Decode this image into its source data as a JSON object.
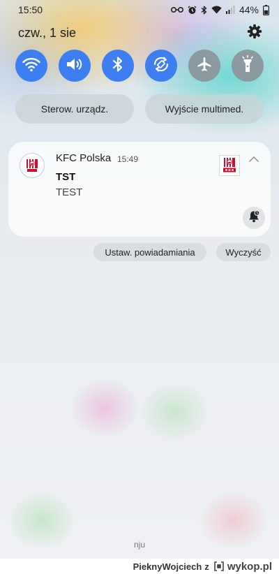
{
  "status_bar": {
    "time": "15:50",
    "battery_percent": "44%",
    "icons": [
      "key-icon",
      "alarm-icon",
      "bluetooth-icon",
      "wifi-icon",
      "signal-icon",
      "battery-icon"
    ]
  },
  "panel": {
    "date": "czw., 1 sie",
    "settings_icon": "gear-icon"
  },
  "quick_settings": [
    {
      "name": "wifi",
      "icon": "wifi-icon",
      "state": "on"
    },
    {
      "name": "sound",
      "icon": "volume-icon",
      "state": "on"
    },
    {
      "name": "bluetooth",
      "icon": "bluetooth-icon",
      "state": "on"
    },
    {
      "name": "auto-rotate",
      "icon": "rotate-icon",
      "state": "on"
    },
    {
      "name": "airplane",
      "icon": "airplane-icon",
      "state": "off"
    },
    {
      "name": "flashlight",
      "icon": "flashlight-icon",
      "state": "off"
    }
  ],
  "pills": {
    "devices": "Sterow. urządz.",
    "media": "Wyjście multimed."
  },
  "notification": {
    "app_name": "KFC Polska",
    "time": "15:49",
    "title": "TST",
    "body": "TEST",
    "logo_text": "KFC"
  },
  "actions": {
    "settings": "Ustaw. powiadamiania",
    "clear": "Wyczyść"
  },
  "carrier": "nju",
  "watermark": {
    "user": "PieknyWojciech",
    "connector": "z",
    "site": "wykop.pl"
  },
  "colors": {
    "toggle_on": "#3d7ff0",
    "toggle_off": "#8a9aa0",
    "kfc_red": "#c8102e"
  }
}
